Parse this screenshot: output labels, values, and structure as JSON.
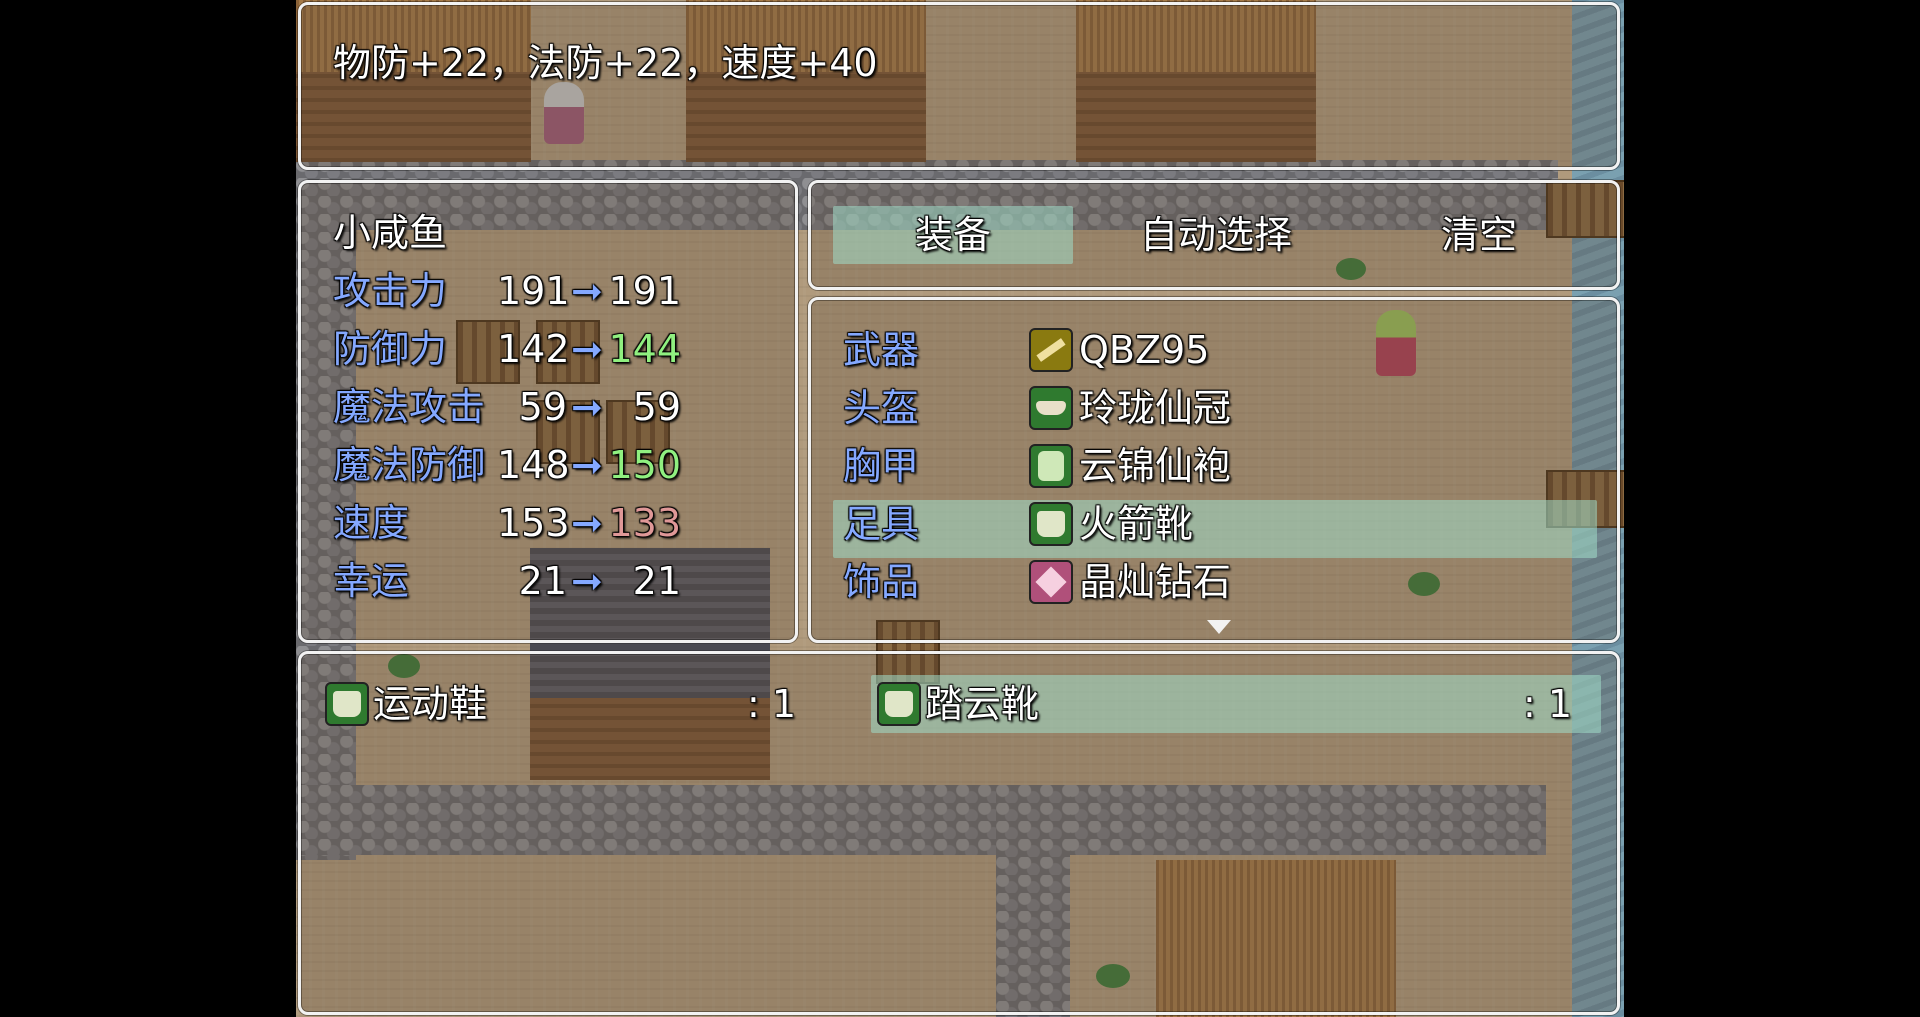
{
  "help": {
    "text": "物防+22，法防+22，速度+40"
  },
  "actor": {
    "name": "小咸鱼",
    "params": [
      {
        "label": "攻击力",
        "before": "191",
        "after": "191",
        "change": "same"
      },
      {
        "label": "防御力",
        "before": "142",
        "after": "144",
        "change": "up"
      },
      {
        "label": "魔法攻击",
        "before": "59",
        "after": "59",
        "change": "same"
      },
      {
        "label": "魔法防御",
        "before": "148",
        "after": "150",
        "change": "up"
      },
      {
        "label": "速度",
        "before": "153",
        "after": "133",
        "change": "down"
      },
      {
        "label": "幸运",
        "before": "21",
        "after": "21",
        "change": "same"
      }
    ],
    "arrow": "➞"
  },
  "commands": {
    "equip": "装备",
    "optimize": "自动选择",
    "clear": "清空",
    "selected": "equip"
  },
  "slots": [
    {
      "slot": "武器",
      "item": "QBZ95",
      "icon": "gun-icon"
    },
    {
      "slot": "头盔",
      "item": "玲珑仙冠",
      "icon": "hat-icon"
    },
    {
      "slot": "胸甲",
      "item": "云锦仙袍",
      "icon": "armor-icon"
    },
    {
      "slot": "足具",
      "item": "火箭靴",
      "icon": "boot-icon",
      "selected": true
    },
    {
      "slot": "饰品",
      "item": "晶灿钻石",
      "icon": "gem-icon"
    }
  ],
  "items": [
    {
      "name": "运动鞋",
      "count": ": 1",
      "icon": "boot-icon"
    },
    {
      "name": "踏云靴",
      "count": ": 1",
      "icon": "boot-icon",
      "selected": true
    }
  ],
  "colors": {
    "system": "#84a8ff",
    "power_up": "#90f080",
    "power_down": "#e09898",
    "window_border": "#f2f2f2",
    "cursor": "#a0dcc8"
  }
}
